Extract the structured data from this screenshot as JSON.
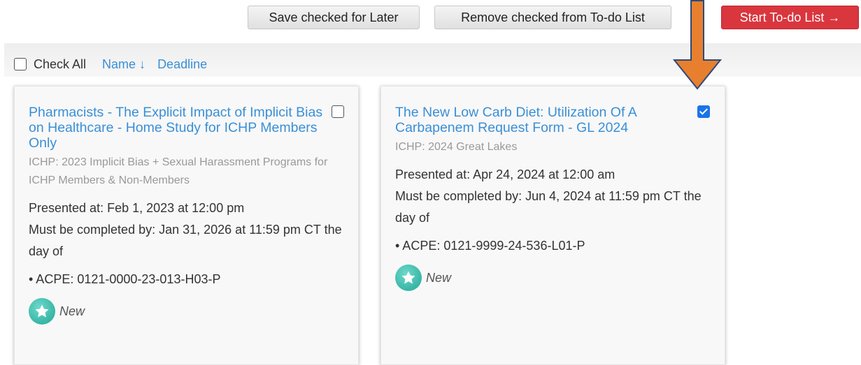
{
  "actions": {
    "save_label": "Save checked for Later",
    "remove_label": "Remove checked from To-do List",
    "start_label": "Start To-do List →",
    "start_color": "#d9363e"
  },
  "toolbar": {
    "check_all_label": "Check All",
    "check_all_checked": false,
    "sort_name_label": "Name ↓",
    "sort_deadline_label": "Deadline"
  },
  "cards": [
    {
      "title": "Pharmacists - The Explicit Impact of Implicit Bias on Healthcare - Home Study for ICHP Members Only",
      "org": "ICHP: 2023 Implicit Bias + Sexual Harassment Programs for ICHP Members & Non-Members",
      "presented": "Presented at: Feb 1, 2023 at 12:00 pm",
      "deadline": "Must be completed by: Jan 31, 2026 at 11:59 pm CT the day of",
      "acpe": "• ACPE: 0121-0000-23-013-H03-P",
      "badge_icon": "star-icon",
      "badge_label": "New",
      "checked": false
    },
    {
      "title": "The New Low Carb Diet: Utilization Of A Carbapenem Request Form - GL 2024",
      "org": "ICHP: 2024 Great Lakes",
      "presented": "Presented at: Apr 24, 2024 at 12:00 am",
      "deadline": "Must be completed by: Jun 4, 2024 at 11:59 pm CT the day of",
      "acpe": "• ACPE: 0121-9999-24-536-L01-P",
      "badge_icon": "star-icon",
      "badge_label": "New",
      "checked": true
    }
  ],
  "colors": {
    "link": "#3a8fd6",
    "annotation_arrow": "#e87f2e",
    "checkbox_checked": "#1a73e8"
  }
}
